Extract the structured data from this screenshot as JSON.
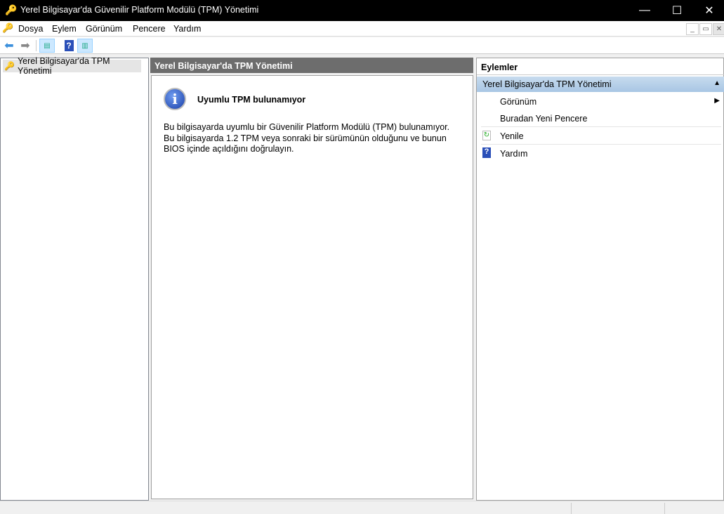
{
  "window": {
    "title": "Yerel Bilgisayar'da Güvenilir Platform Modülü (TPM) Yönetimi"
  },
  "menu": [
    "Dosya",
    "Eylem",
    "Görünüm",
    "Pencere",
    "Yardım"
  ],
  "tree": {
    "item": "Yerel Bilgisayar'da TPM Yönetimi"
  },
  "main": {
    "header": "Yerel Bilgisayar'da TPM Yönetimi",
    "message_title": "Uyumlu TPM bulunamıyor",
    "message_lines": [
      "Bu bilgisayarda uyumlu bir Güvenilir Platform Modülü (TPM) bulunamıyor.",
      "Bu bilgisayarda 1.2 TPM veya sonraki bir sürümünün olduğunu ve bunun",
      "BIOS içinde açıldığını doğrulayın."
    ]
  },
  "actions": {
    "header": "Eylemler",
    "section": "Yerel Bilgisayar'da TPM Yönetimi",
    "items": [
      {
        "label": "Görünüm",
        "icon": "submenu-arrow-icon"
      },
      {
        "label": "Buradan Yeni Pencere"
      },
      {
        "label": "Yenile",
        "icon": "refresh-icon"
      },
      {
        "label": "Yardım",
        "icon": "help-icon"
      }
    ]
  },
  "colors": {
    "titlebar": "#000000",
    "section": "#b8d1ea",
    "main_header": "#6d6d6d"
  }
}
